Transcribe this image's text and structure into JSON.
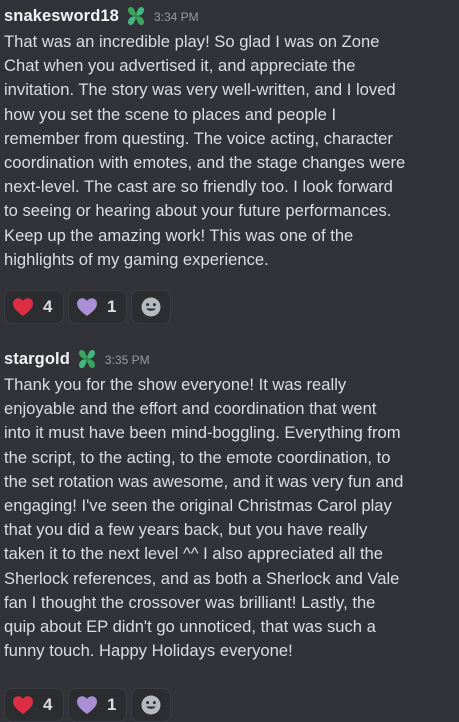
{
  "messages": [
    {
      "username": "snakesword18",
      "badge_icon": "green-clover-leaf-icon",
      "timestamp": "3:34 PM",
      "text": "That was an incredible play! So glad I was on Zone\nChat when you advertised it, and appreciate the\ninvitation. The story was very well-written, and I loved\nhow you set the scene to places and people I\nremember from questing. The voice acting, character\ncoordination with emotes, and the stage changes were\nnext-level. The cast are so friendly too. I look forward\nto seeing or hearing about your future performances.\nKeep up the amazing work! This was one of the\nhighlights of my gaming experience.",
      "reactions": [
        {
          "emoji": "red-heart",
          "count": "4"
        },
        {
          "emoji": "purple-heart",
          "count": "1"
        }
      ]
    },
    {
      "username": "stargold",
      "badge_icon": "green-clover-leaf-icon",
      "timestamp": "3:35 PM",
      "text": "Thank you for the show everyone! It was really\nenjoyable and the effort and coordination that went\ninto it must have been mind-boggling. Everything from\nthe script, to the acting, to the emote coordination, to\nthe set rotation was awesome, and it was very fun and\nengaging! I've seen the original Christmas Carol play\nthat you did a few years back, but you have really\ntaken it to the next level ^^ I also appreciated all the\nSherlock references, and as both a Sherlock and Vale\nfan I thought the crossover was brilliant! Lastly, the\nquip about EP didn't go unnoticed, that was such a\nfunny touch. Happy Holidays everyone!",
      "reactions": [
        {
          "emoji": "red-heart",
          "count": "4"
        },
        {
          "emoji": "purple-heart",
          "count": "1"
        }
      ]
    }
  ],
  "colors": {
    "background": "#313338",
    "username": "#f2f3f5",
    "text": "#dbdee1",
    "timestamp": "#949ba4",
    "reaction_bg": "#2b2d31",
    "red_heart": "#dd2e44",
    "purple_heart": "#aa8ed6",
    "leaf_green": "#3ba55c"
  }
}
